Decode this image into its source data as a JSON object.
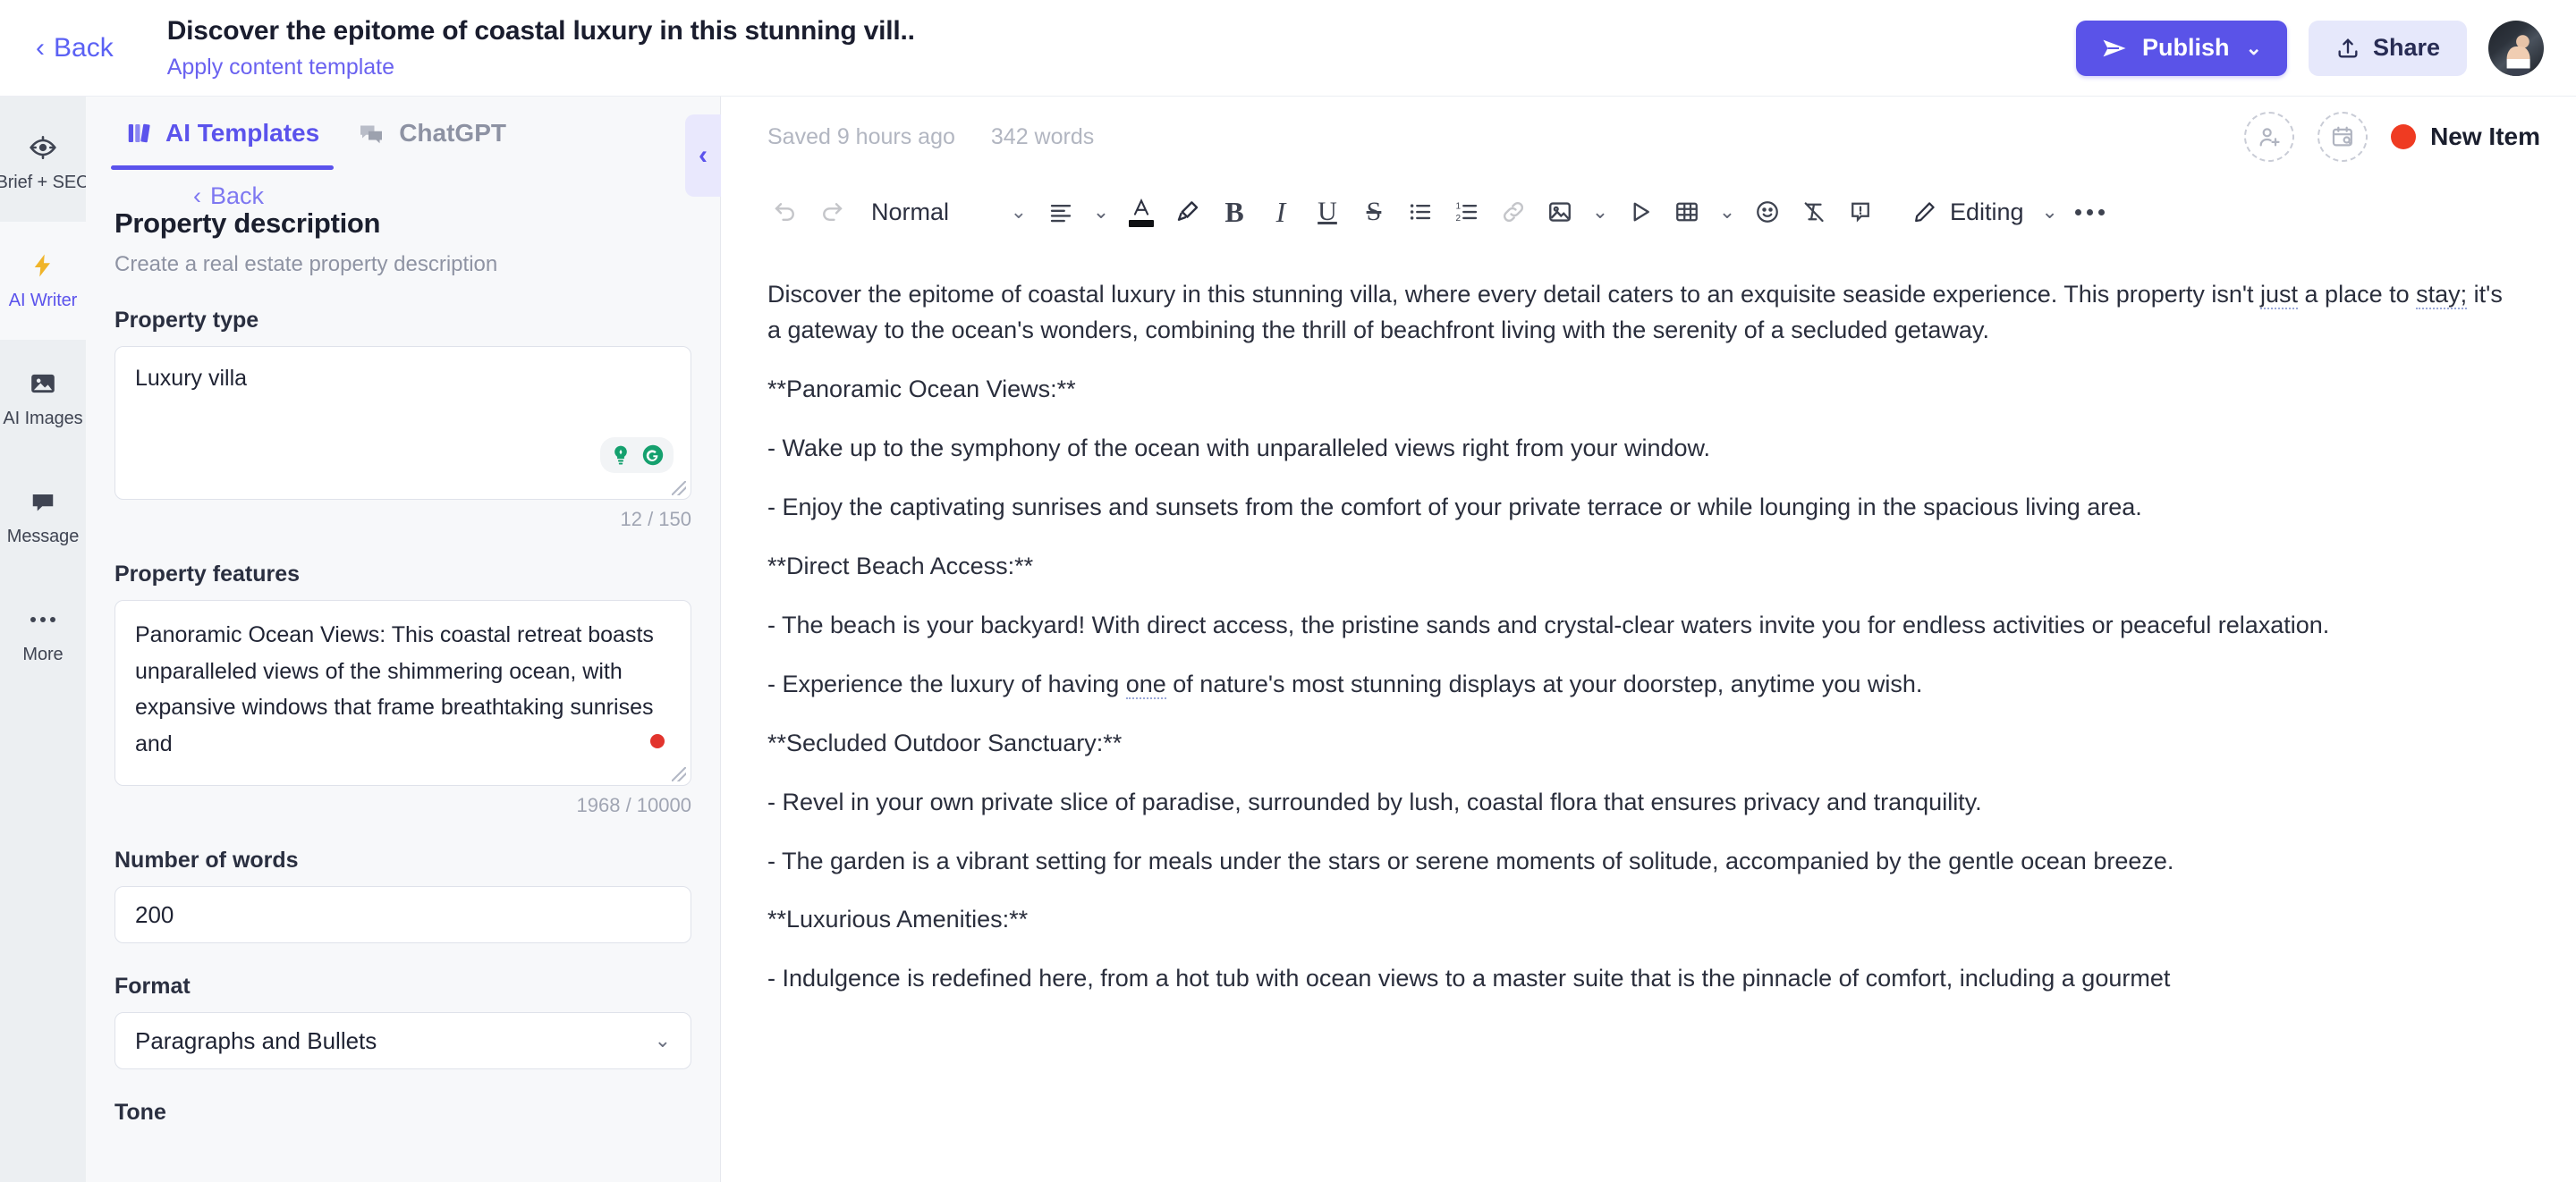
{
  "header": {
    "back_label": "Back",
    "back_icon": "chevron-left-icon",
    "doc_title": "Discover the epitome of coastal luxury in this stunning vill..",
    "apply_template_label": "Apply content template",
    "publish_label": "Publish",
    "publish_icon": "paper-plane-icon",
    "publish_chevron": "⌄",
    "share_label": "Share",
    "share_icon": "upload-icon",
    "accent_color": "#5a53e8",
    "share_bg_color": "#e6e8fb"
  },
  "rail": {
    "items": [
      {
        "label": "Brief + SEO",
        "icon": "target-icon",
        "active": false
      },
      {
        "label": "AI Writer",
        "icon": "lightning-icon",
        "active": true
      },
      {
        "label": "AI Images",
        "icon": "image-icon",
        "active": false
      },
      {
        "label": "Message",
        "icon": "chat-bubble-icon",
        "active": false
      },
      {
        "label": "More",
        "icon": "ellipsis-icon",
        "active": false
      }
    ]
  },
  "panel": {
    "tabs": [
      {
        "label": "AI Templates",
        "icon": "templates-icon",
        "active": true
      },
      {
        "label": "ChatGPT",
        "icon": "chat-bubbles-icon",
        "active": false
      }
    ],
    "back_label": "Back",
    "template_title": "Property description",
    "template_subtitle": "Create a real estate property description",
    "collapse_icon": "chevron-left-icon",
    "fields": {
      "property_type": {
        "label": "Property type",
        "value": "Luxury villa",
        "counter": "12 / 150"
      },
      "property_features": {
        "label": "Property features",
        "value": "Panoramic Ocean Views: This coastal retreat boasts unparalleled views of the shimmering ocean, with expansive windows that frame breathtaking sunrises and",
        "counter": "1968 / 10000"
      },
      "number_of_words": {
        "label": "Number of words",
        "value": "200"
      },
      "format": {
        "label": "Format",
        "value": "Paragraphs and Bullets",
        "chevron": "⌄"
      },
      "tone": {
        "label": "Tone"
      }
    }
  },
  "editor": {
    "saved_status": "Saved 9 hours ago",
    "word_count": "342 words",
    "invite_icon": "add-person-icon",
    "schedule_icon": "calendar-search-icon",
    "new_item_label": "New Item",
    "new_item_dot_color": "#ef3b22",
    "toolbar": {
      "undo_icon": "undo-icon",
      "redo_icon": "redo-icon",
      "style_label": "Normal",
      "style_chevron": "⌄",
      "align_icon": "align-left-icon",
      "align_chevron": "⌄",
      "text_color_icon": "text-color-icon",
      "highlight_icon": "highlighter-icon",
      "bold_label": "B",
      "italic_label": "I",
      "underline_label": "U",
      "strike_label": "S",
      "bullet_list_icon": "bullet-list-icon",
      "numbered_list_icon": "numbered-list-icon",
      "link_icon": "link-icon",
      "image_icon": "image-icon",
      "image_chevron": "⌄",
      "video_icon": "play-icon",
      "table_icon": "table-icon",
      "table_chevron": "⌄",
      "emoji_icon": "emoji-icon",
      "clear_format_icon": "clear-format-icon",
      "comment_icon": "comment-icon",
      "editing_icon": "pencil-icon",
      "editing_label": "Editing",
      "editing_chevron": "⌄",
      "more_icon": "ellipsis-icon"
    },
    "document": {
      "p1_a": "Discover the epitome of coastal luxury in this stunning villa, where every detail caters to an exquisite seaside experience. This property isn't ",
      "p1_sp1": "just",
      "p1_b": " a place to ",
      "p1_sp2": "stay;",
      "p1_c": " it's a gateway to the ocean's wonders, combining the thrill of beachfront living with the serenity of a secluded getaway.",
      "h1": "**Panoramic Ocean Views:**",
      "b1": "- Wake up to the symphony of the ocean with unparalleled views right from your window.",
      "b2": "- Enjoy the captivating sunrises and sunsets from the comfort of your private terrace or while lounging in the spacious living area.",
      "h2": "**Direct Beach Access:**",
      "b3": "- The beach is your backyard! With direct access, the pristine sands and crystal-clear waters invite you for endless activities or peaceful relaxation.",
      "b4_a": "- Experience the luxury of having ",
      "b4_sp": "one",
      "b4_b": " of nature's most stunning displays at your doorstep, anytime you wish.",
      "h3": "**Secluded Outdoor Sanctuary:**",
      "b5": "- Revel in your own private slice of paradise, surrounded by lush, coastal flora that ensures privacy and tranquility.",
      "b6": "- The garden is a vibrant setting for meals under the stars or serene moments of solitude, accompanied by the gentle ocean breeze.",
      "h4": "**Luxurious Amenities:**",
      "b7": "- Indulgence is redefined here, from a hot tub with ocean views to a master suite that is the pinnacle of comfort, including a gourmet"
    }
  }
}
